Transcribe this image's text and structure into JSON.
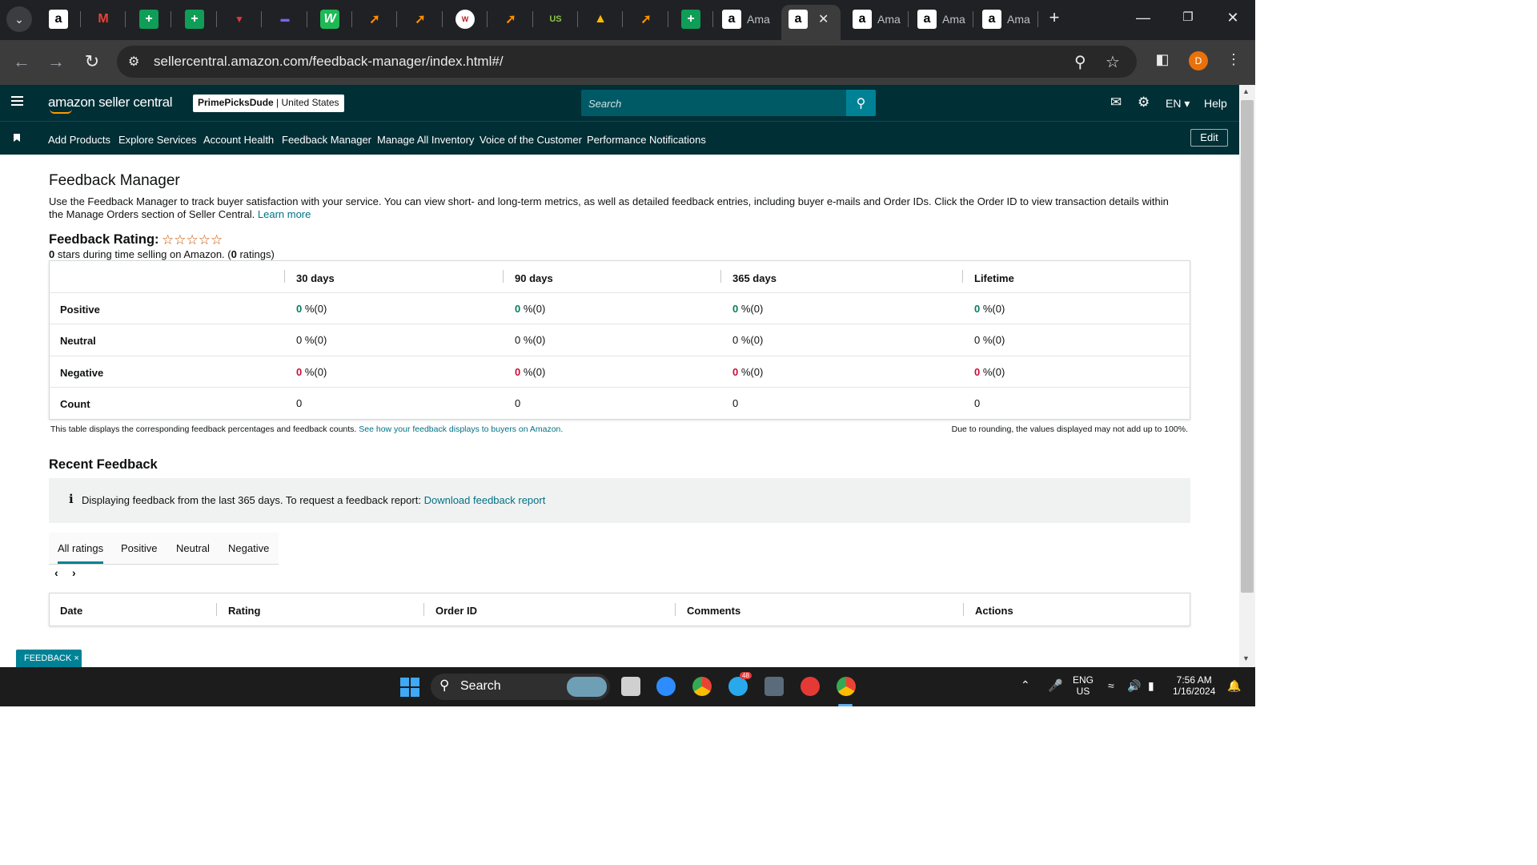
{
  "browser": {
    "tabs": [
      {
        "label": "Ama"
      },
      {
        "label": "Ama"
      },
      {
        "label": "Ama"
      },
      {
        "label": "Ama"
      }
    ],
    "url": "sellercentral.amazon.com/feedback-manager/index.html#/",
    "profile_initial": "D"
  },
  "header": {
    "logo": "amazon seller central",
    "account_store": "PrimePicksDude",
    "account_region": "United States",
    "search_placeholder": "Search",
    "language": "EN",
    "help": "Help"
  },
  "nav": {
    "links": [
      "Add Products",
      "Explore Services",
      "Account Health",
      "Feedback Manager",
      "Manage All Inventory",
      "Voice of the Customer",
      "Performance Notifications"
    ],
    "edit": "Edit"
  },
  "page": {
    "title": "Feedback Manager",
    "description": "Use the Feedback Manager to track buyer satisfaction with your service. You can view short- and long-term metrics, as well as detailed feedback entries, including buyer e-mails and Order IDs. Click the Order ID to view transaction details within the Manage Orders section of Seller Central.",
    "learn_more": "Learn more",
    "rating_label": "Feedback Rating:",
    "stars_value": "0",
    "rating_sub_a": " stars during time selling on Amazon. (",
    "rating_count": "0",
    "rating_sub_b": " ratings)"
  },
  "feedback_table": {
    "columns": [
      "30 days",
      "90 days",
      "365 days",
      "Lifetime"
    ],
    "rows": [
      {
        "label": "Positive",
        "values": [
          "0",
          "0",
          "0",
          "0"
        ],
        "suffix": " %(0)"
      },
      {
        "label": "Neutral",
        "values": [
          "0",
          "0",
          "0",
          "0"
        ],
        "suffix": " %(0)"
      },
      {
        "label": "Negative",
        "values": [
          "0",
          "0",
          "0",
          "0"
        ],
        "suffix": " %(0)"
      },
      {
        "label": "Count",
        "values": [
          "0",
          "0",
          "0",
          "0"
        ],
        "suffix": ""
      }
    ],
    "note_left": "This table displays the corresponding feedback percentages and feedback counts.",
    "note_link": "See how your feedback displays to buyers on Amazon.",
    "note_right": "Due to rounding, the values displayed may not add up to 100%."
  },
  "recent": {
    "title": "Recent Feedback",
    "info_text": "Displaying feedback from the last 365 days. To request a feedback report:",
    "info_link": "Download feedback report",
    "tabs": [
      "All ratings",
      "Positive",
      "Neutral",
      "Negative"
    ],
    "columns": [
      "Date",
      "Rating",
      "Order ID",
      "Comments",
      "Actions"
    ]
  },
  "feedback_button": "FEEDBACK",
  "taskbar": {
    "search": "Search",
    "lang1": "ENG",
    "lang2": "US",
    "time": "7:56 AM",
    "date": "1/16/2024",
    "telegram_badge": "48"
  }
}
